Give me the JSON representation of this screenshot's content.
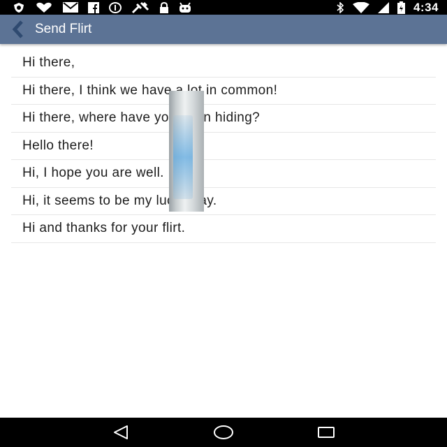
{
  "status_bar": {
    "time": "4:34",
    "left_icons": [
      "shield-icon",
      "heart-icon",
      "mail-icon",
      "facebook-icon",
      "info-icon",
      "satellite-icon",
      "lock-icon",
      "android-icon"
    ],
    "right_icons": [
      "bluetooth-icon",
      "wifi-icon",
      "signal-icon",
      "battery-icon"
    ]
  },
  "app_bar": {
    "title": "Send Flirt",
    "background": "#5c7395"
  },
  "messages": [
    {
      "text": "Hi there,"
    },
    {
      "text": "Hi there, I think we have a lot in common!"
    },
    {
      "text": "Hi there, where have you been hiding?"
    },
    {
      "text": "Hello there!"
    },
    {
      "text": "Hi, I hope you are well."
    },
    {
      "text": "Hi, it seems to be my lucky day."
    },
    {
      "text": "Hi and thanks for your flirt."
    }
  ],
  "nav_bar": {
    "buttons": [
      "back-triangle-icon",
      "home-circle-icon",
      "recents-square-icon"
    ]
  }
}
